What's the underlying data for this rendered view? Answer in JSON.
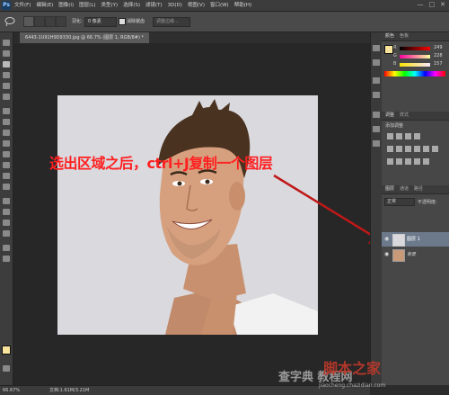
{
  "menubar": {
    "logo": "Ps",
    "items": [
      "文件(F)",
      "编辑(E)",
      "图像(I)",
      "图层(L)",
      "类型(Y)",
      "选择(S)",
      "滤镜(T)",
      "3D(D)",
      "视图(V)",
      "窗口(W)",
      "帮助(H)"
    ],
    "window_buttons": [
      "—",
      "□",
      "✕"
    ]
  },
  "options": {
    "feather_label": "羽化:",
    "feather_value": "0 像素",
    "antialias_label": "消除锯齿",
    "refine_edge": "调整边缘..."
  },
  "document": {
    "tab_label": "6443-1U91H9D9330.jpg @ 66.7% (图层 1, RGB/8#) *"
  },
  "annotation": {
    "text": "选出区域之后，ctrl+J复制一个图层"
  },
  "color_panel": {
    "title": "颜色",
    "tab2": "色板",
    "r": "249",
    "g": "228",
    "b": "157"
  },
  "adjust_panel": {
    "title": "调整",
    "tab2": "样式",
    "subtitle": "添加调整"
  },
  "layers_panel": {
    "title": "图层",
    "tab2": "通道",
    "tab3": "路径",
    "blend_mode": "正常",
    "opacity_label": "不透明度:",
    "layers": [
      {
        "name": "图层 1"
      },
      {
        "name": "背景"
      }
    ]
  },
  "status": {
    "zoom": "66.67%",
    "doc_info": "文档:1.61M/3.21M"
  },
  "watermarks": {
    "brand1": "脚本之家",
    "brand2": "查字典 教程网",
    "url": "jiaocheng.chazidian.com"
  }
}
